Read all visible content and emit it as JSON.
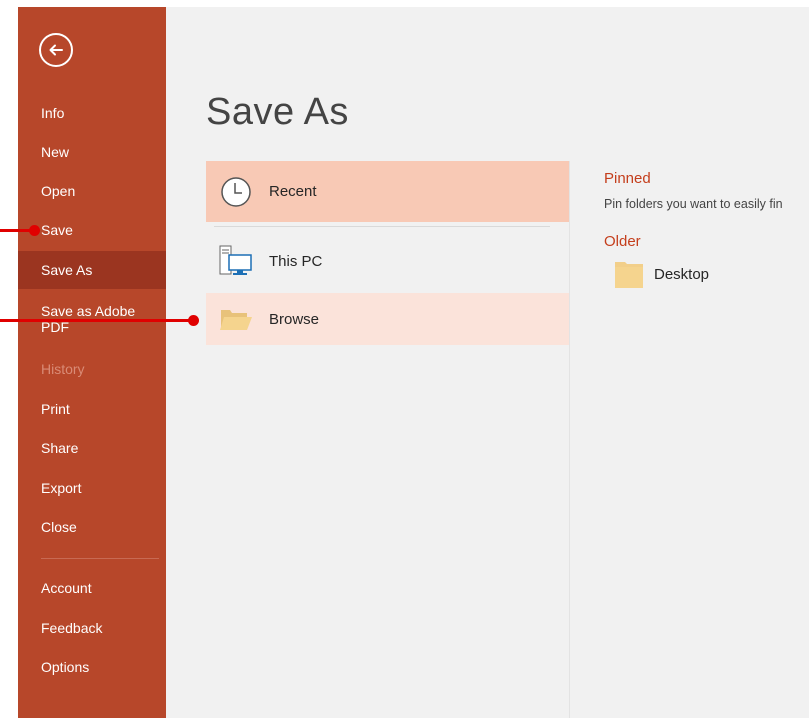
{
  "sidebar": {
    "back_icon": "back-arrow-icon",
    "items": [
      {
        "label": "Info"
      },
      {
        "label": "New"
      },
      {
        "label": "Open"
      },
      {
        "label": "Save"
      },
      {
        "label": "Save As"
      },
      {
        "label": "Save as Adobe",
        "label2": "PDF"
      },
      {
        "label": "History"
      },
      {
        "label": "Print"
      },
      {
        "label": "Share"
      },
      {
        "label": "Export"
      },
      {
        "label": "Close"
      },
      {
        "label": "Account"
      },
      {
        "label": "Feedback"
      },
      {
        "label": "Options"
      }
    ],
    "active_item": "Save As",
    "disabled_item": "History"
  },
  "main": {
    "title": "Save As",
    "locations": [
      {
        "label": "Recent",
        "icon": "clock-icon"
      },
      {
        "label": "This PC",
        "icon": "computer-icon"
      },
      {
        "label": "Browse",
        "icon": "folder-open-icon"
      }
    ],
    "pinned": {
      "heading": "Pinned",
      "description": "Pin folders you want to easily fin"
    },
    "older": {
      "heading": "Older",
      "items": [
        {
          "label": "Desktop",
          "icon": "folder-icon"
        }
      ]
    }
  },
  "colors": {
    "sidebar": "#b7472a",
    "sidebar_active": "#9b3520",
    "accent_text": "#c43e1c",
    "recent_highlight": "#f8c9b5",
    "browse_highlight": "#fbe3da",
    "annotation": "#e00000"
  }
}
